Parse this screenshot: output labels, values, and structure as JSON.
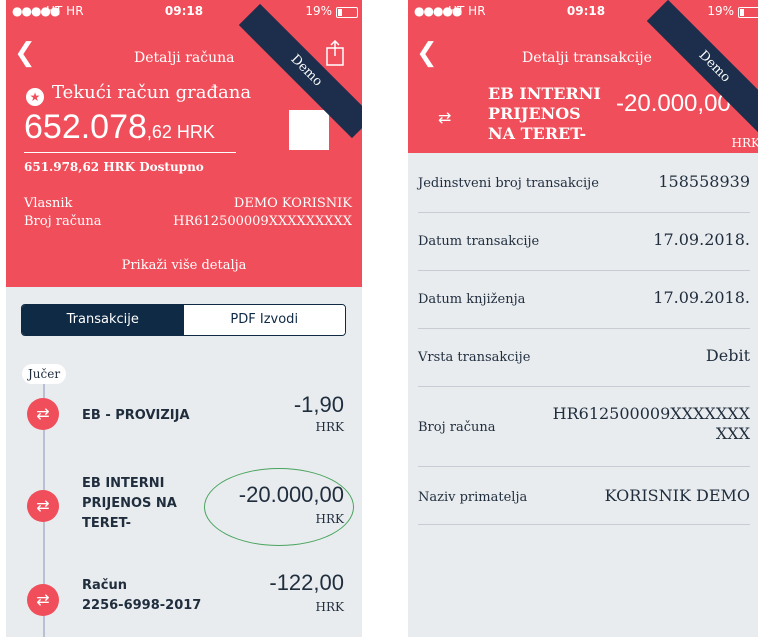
{
  "left": {
    "status": {
      "signal": "●●●●●",
      "carrier": "HT HR",
      "time": "09:18",
      "battery": "19%"
    },
    "nav": {
      "title": "Detalji računa"
    },
    "account": {
      "name": "Tekući račun građana",
      "balance_whole": "652.078",
      "balance_decimal": ",62 HRK",
      "available": "651.978,62 HRK Dostupno",
      "owner_label": "Vlasnik",
      "owner_value": "DEMO KORISNIK",
      "number_label": "Broj računa",
      "number_value": "HR612500009XXXXXXXXX"
    },
    "more_details": "Prikaži više detalja",
    "tabs": [
      {
        "label": "Transakcije"
      },
      {
        "label": "PDF Izvodi"
      }
    ],
    "day_label": "Jučer",
    "transactions": [
      {
        "title_lines": [
          "EB - PROVIZIJA"
        ],
        "amount": "-1,90",
        "currency": "HRK"
      },
      {
        "title_lines": [
          "EB INTERNI",
          "PRIJENOS NA",
          "TERET-"
        ],
        "amount": "-20.000,00",
        "currency": "HRK"
      },
      {
        "title_lines": [
          "Račun",
          "2256-6998-2017"
        ],
        "amount": "-122,00",
        "currency": "HRK"
      }
    ]
  },
  "right": {
    "status": {
      "signal": "●●●●●",
      "carrier": "HT HR",
      "time": "09:18",
      "battery": "19%"
    },
    "nav": {
      "title": "Detalji transakcije"
    },
    "header": {
      "title_lines": [
        "EB INTERNI",
        "PRIJENOS",
        "NA TERET-"
      ],
      "amount": "-20.000,00",
      "currency": "HRK"
    },
    "details": [
      {
        "label": "Jedinstveni broj transakcije",
        "value": "158558939"
      },
      {
        "label": "Datum transakcije",
        "value": "17.09.2018."
      },
      {
        "label": "Datum knjiženja",
        "value": "17.09.2018."
      },
      {
        "label": "Vrsta transakcije",
        "value": "Debit"
      },
      {
        "label": "Broj računa",
        "value_lines": [
          "HR612500009XXXXXXX",
          "XXX"
        ]
      },
      {
        "label": "Naziv primatelja",
        "value": "KORISNIK DEMO"
      }
    ]
  },
  "ribbon": {
    "label": "Demo"
  },
  "colors": {
    "brand_red": "#f04e5a",
    "navy": "#0f2a44",
    "ribbon": "#1c2e4b",
    "highlight": "#49a45e",
    "background": "#e9ecef"
  },
  "icons": [
    "back-icon",
    "share-icon",
    "star-icon",
    "transfer-icon",
    "battery-icon",
    "wifi-icon"
  ]
}
